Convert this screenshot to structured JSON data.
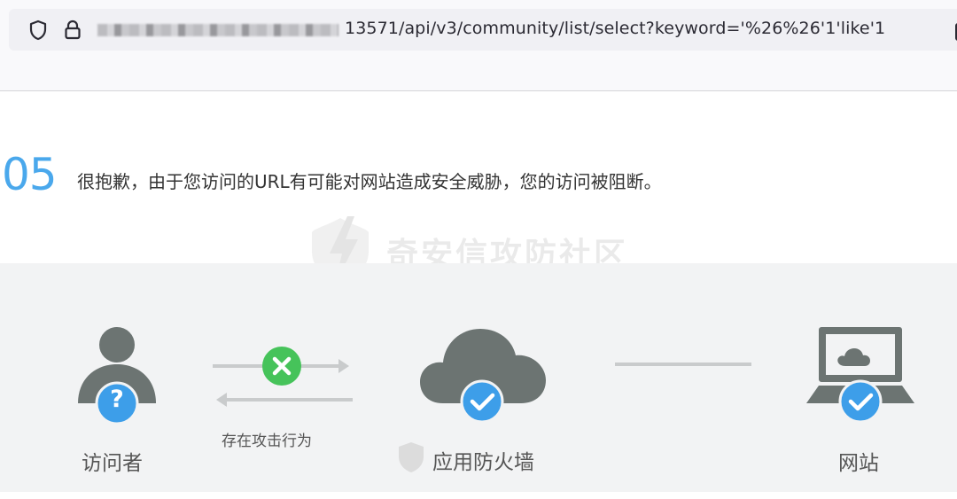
{
  "browser": {
    "url": "13571/api/v3/community/list/select?keyword='%26%26'1'like'1"
  },
  "error": {
    "code": "05",
    "message": "很抱歉，由于您访问的URL有可能对网站造成安全威胁，您的访问被阻断。"
  },
  "watermark": {
    "text": "奇安信攻防社区"
  },
  "diagram": {
    "visitor_label": "访问者",
    "attack_label": "存在攻击行为",
    "firewall_label": "应用防火墙",
    "website_label": "网站",
    "colors": {
      "icon_gray": "#6c7472",
      "blue_badge": "#3d9ee9",
      "green_badge": "#46c35a",
      "arrow": "#c9cbcc"
    }
  }
}
